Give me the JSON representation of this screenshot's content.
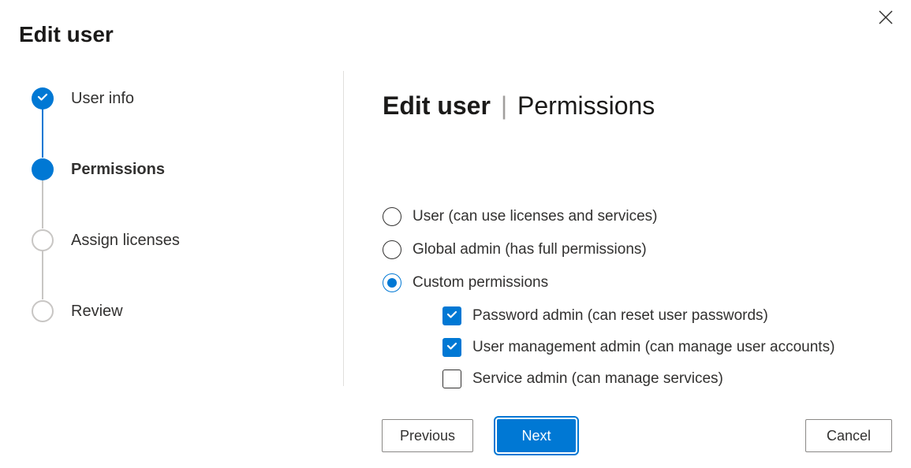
{
  "page_title": "Edit user",
  "panel": {
    "heading_bold": "Edit user",
    "heading_light": "Permissions"
  },
  "stepper": {
    "steps": [
      {
        "label": "User info",
        "state": "completed"
      },
      {
        "label": "Permissions",
        "state": "current"
      },
      {
        "label": "Assign licenses",
        "state": "pending"
      },
      {
        "label": "Review",
        "state": "pending"
      }
    ]
  },
  "permissions": {
    "radios": [
      {
        "label": "User (can use licenses and services)",
        "selected": false
      },
      {
        "label": "Global admin (has full permissions)",
        "selected": false
      },
      {
        "label": "Custom permissions",
        "selected": true
      }
    ],
    "custom_checkboxes": [
      {
        "label": "Password admin (can reset user passwords)",
        "checked": true
      },
      {
        "label": "User management admin (can manage user accounts)",
        "checked": true
      },
      {
        "label": "Service admin (can manage services)",
        "checked": false
      }
    ]
  },
  "buttons": {
    "previous": "Previous",
    "next": "Next",
    "cancel": "Cancel"
  }
}
